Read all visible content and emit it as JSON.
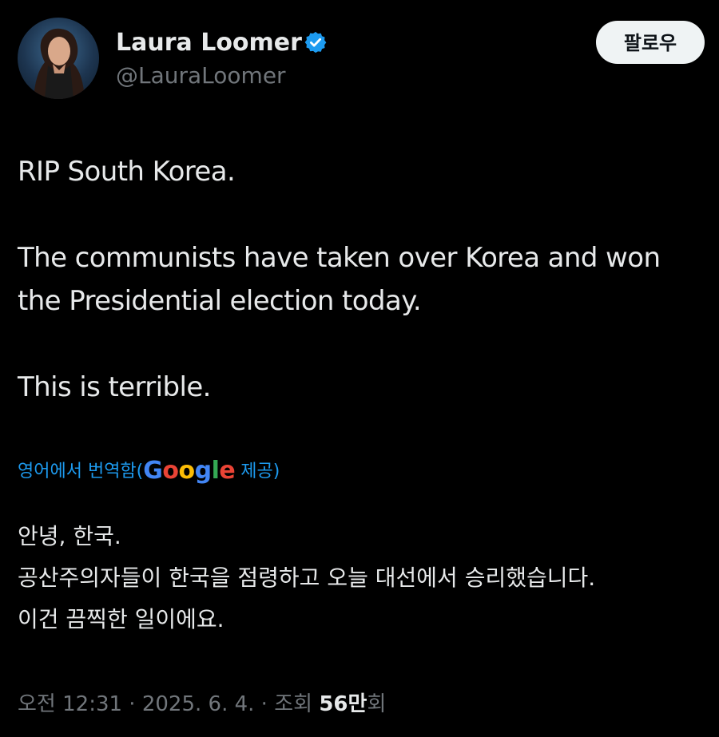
{
  "author": {
    "display_name": "Laura Loomer",
    "handle": "@LauraLoomer",
    "verified_icon": "verified-badge-icon",
    "avatar_icon": "profile-photo"
  },
  "follow_button": {
    "label": "팔로우"
  },
  "tweet": {
    "lines": [
      "RIP South Korea.",
      "The communists have taken over Korea and won",
      "the Presidential election today.",
      "This is terrible."
    ]
  },
  "translation_notice": {
    "prefix": "영어에서 번역함(",
    "provider_letters": [
      "G",
      "o",
      "o",
      "g",
      "l",
      "e"
    ],
    "suffix": " 제공)"
  },
  "translation": {
    "lines": [
      "안녕, 한국.",
      "공산주의자들이 한국을 점령하고 오늘 대선에서 승리했습니다.",
      "이건 끔찍한 일이에요."
    ]
  },
  "meta": {
    "time": "오전 12:31",
    "separator": " · ",
    "date": "2025. 6. 4.",
    "views_label": "조회 ",
    "views_count": "56만",
    "views_suffix": "회"
  },
  "colors": {
    "background": "#000000",
    "text_primary": "#e7e9ea",
    "text_secondary": "#71767b",
    "accent": "#1d9bf0",
    "follow_button_bg": "#eff3f4"
  }
}
